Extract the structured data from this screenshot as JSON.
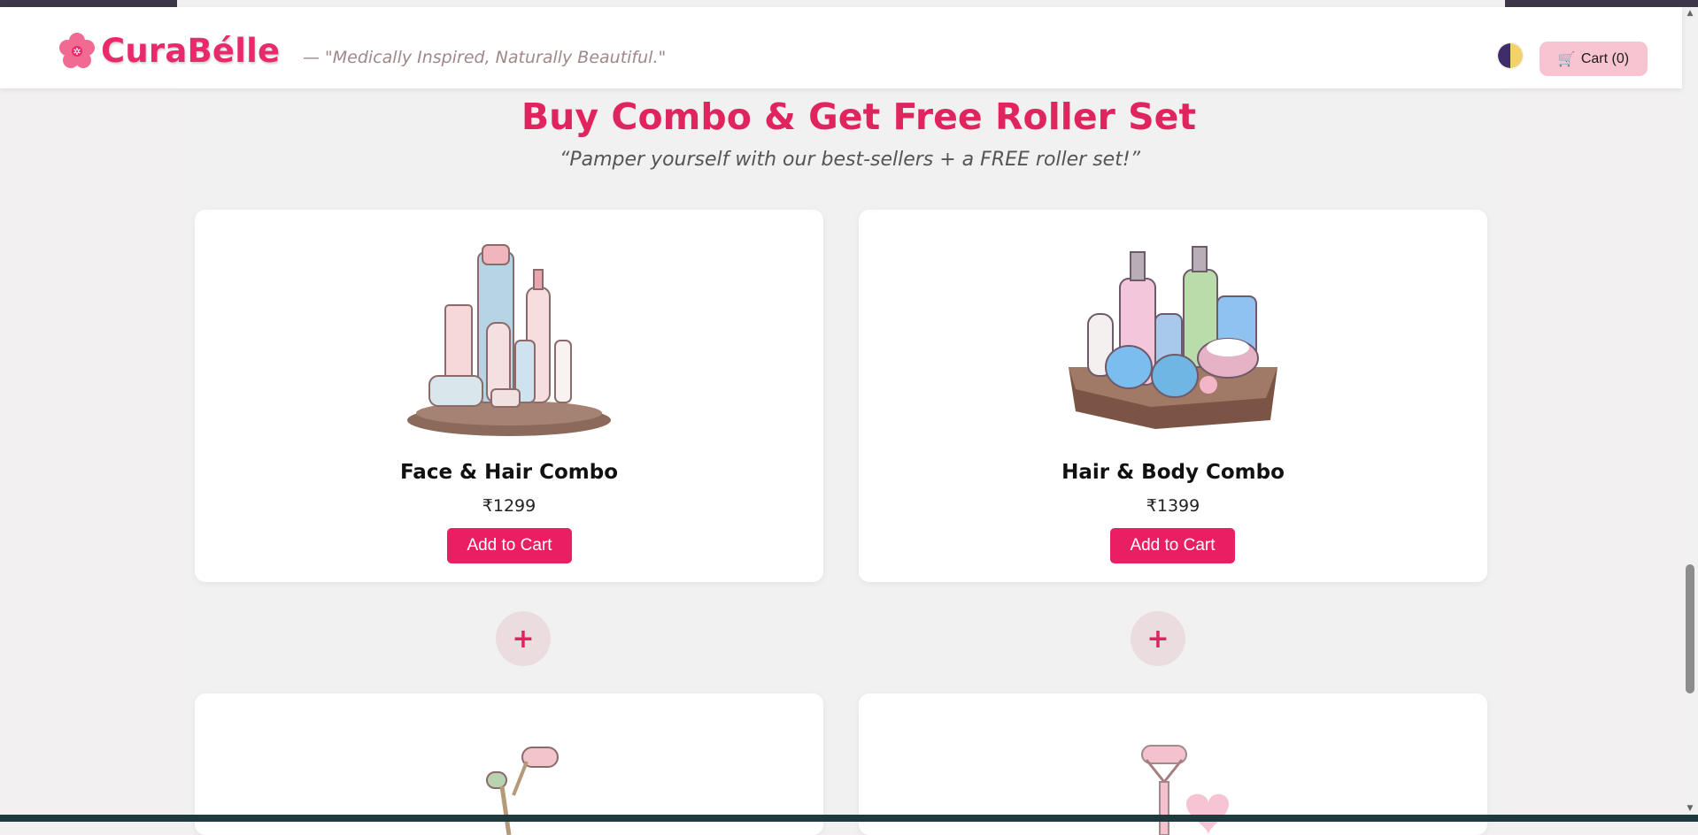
{
  "header": {
    "brand_name": "CuraBélle",
    "tagline": "— \"Medically Inspired, Naturally Beautiful.\"",
    "cart_label": "Cart (0)",
    "cart_icon": "🛒",
    "theme_toggle_icon": "half-moon-icon"
  },
  "section": {
    "title": "Buy Combo & Get Free Roller Set",
    "title_icon": "gift-icon",
    "subtitle": "“Pamper yourself with our best-sellers + a FREE roller set!”"
  },
  "products": [
    {
      "name": "Face & Hair Combo",
      "price": "₹1299",
      "button": "Add to Cart",
      "image": "skincare-bottles-tray-image"
    },
    {
      "name": "Hair & Body Combo",
      "price": "₹1399",
      "button": "Add to Cart",
      "image": "bodycare-jars-tray-image"
    }
  ],
  "plus_label": "+",
  "colors": {
    "accent": "#e91e63",
    "title": "#e0245e",
    "cart_bg": "#f9c4d2",
    "plus_bg": "#ebdcdf"
  }
}
